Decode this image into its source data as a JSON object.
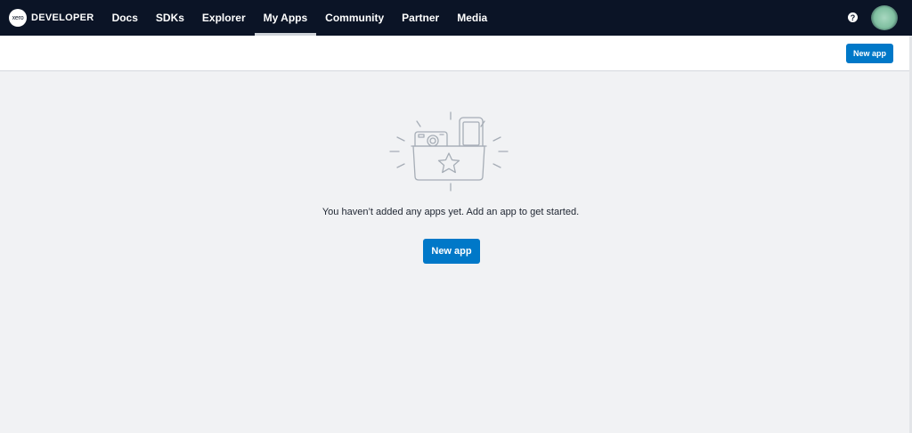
{
  "brand": {
    "logo_text": "xero",
    "label": "DEVELOPER"
  },
  "nav": {
    "items": [
      {
        "label": "Docs"
      },
      {
        "label": "SDKs"
      },
      {
        "label": "Explorer"
      },
      {
        "label": "My Apps",
        "active": true
      },
      {
        "label": "Community"
      },
      {
        "label": "Partner"
      },
      {
        "label": "Media"
      }
    ],
    "help_glyph": "?"
  },
  "subheader": {
    "new_app_label": "New app"
  },
  "empty_state": {
    "message": "You haven’t added any apps yet. Add an app to get started.",
    "new_app_label": "New app",
    "illustration_icon": "app-folder-star-icon"
  },
  "colors": {
    "nav_background": "#0b1426",
    "accent": "#0078c8",
    "page_background": "#f1f2f4"
  }
}
